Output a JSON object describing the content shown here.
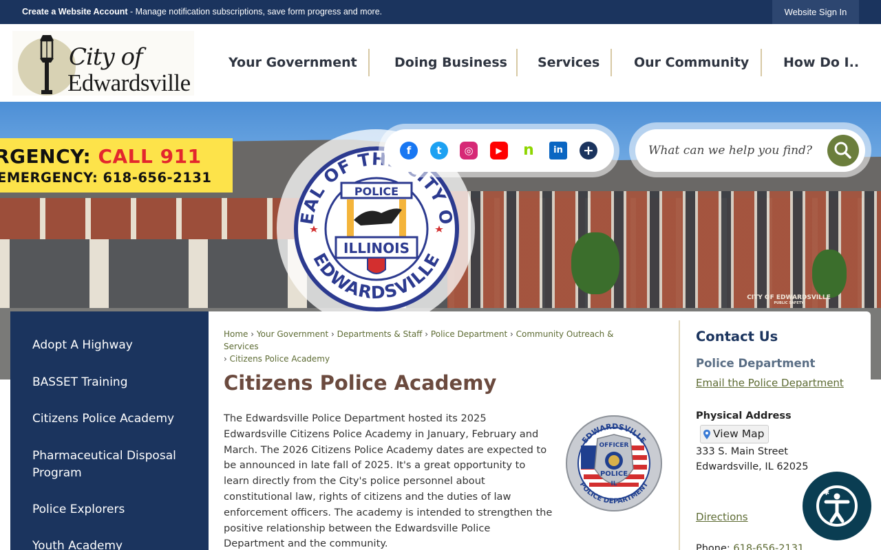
{
  "topbar": {
    "create_account": "Create a Website Account",
    "message": " - Manage notification subscriptions, save form progress and more.",
    "signin": "Website Sign In"
  },
  "logo": {
    "line1": "City of",
    "line2": "Edwardsville"
  },
  "nav": [
    {
      "label": "Your Government"
    },
    {
      "label": "Doing Business"
    },
    {
      "label": "Services"
    },
    {
      "label": "Our Community"
    },
    {
      "label": "How Do I.."
    }
  ],
  "banner": {
    "emergency_prefix": "RGENCY: ",
    "emergency_call": "CALL 911",
    "non_emergency": "EMERGENCY: 618-656-2131",
    "seal_top": "SEAL OF THE CITY OF",
    "seal_bottom": "EDWARDSVILLE",
    "seal_police": "POLICE",
    "seal_state": "ILLINOIS",
    "building_sign": "CITY OF EDWARDSVILLE",
    "building_sub": "PUBLIC SAFETY"
  },
  "social": [
    {
      "icon": "facebook-icon",
      "glyph": "f",
      "color": "#1877f2"
    },
    {
      "icon": "twitter-icon",
      "glyph": "t",
      "color": "#1da1f2"
    },
    {
      "icon": "instagram-icon",
      "glyph": "◎",
      "color": "#d62976"
    },
    {
      "icon": "youtube-icon",
      "glyph": "▶",
      "color": "#ff0000"
    },
    {
      "icon": "nextdoor-icon",
      "glyph": "n",
      "color": "#8ed500"
    },
    {
      "icon": "linkedin-icon",
      "glyph": "in",
      "color": "#0a66c2"
    },
    {
      "icon": "more-icon",
      "glyph": "+",
      "color": "#1b345e"
    }
  ],
  "search": {
    "placeholder": "What can we help you find?"
  },
  "sidebar": {
    "items": [
      {
        "label": "Adopt A Highway"
      },
      {
        "label": "BASSET Training"
      },
      {
        "label": "Citizens Police Academy"
      },
      {
        "label": "Pharmaceutical Disposal Program"
      },
      {
        "label": "Police Explorers"
      },
      {
        "label": "Youth Academy"
      }
    ]
  },
  "breadcrumb": {
    "items": [
      "Home",
      "Your Government",
      "Departments & Staff",
      "Police Department",
      "Community Outreach & Services",
      "Citizens Police Academy"
    ],
    "separator": "›"
  },
  "page": {
    "title": "Citizens Police Academy",
    "body": "The Edwardsville Police Department hosted its 2025 Edwardsville Citizens Police Academy in January, February and March. The 2026 Citizens Police Academy dates are expected to be announced in late fall of 2025. It's a great opportunity to learn directly from the City's police personnel about constitutional law, rights of citizens and the duties of law enforcement officers. The academy is intended to strengthen the positive relationship between the Edwardsville Police Department and the community.",
    "badge_top": "EDWARDSVILLE",
    "badge_bottom": "POLICE DEPARTMENT",
    "badge_officer": "OFFICER",
    "badge_police": "POLICE",
    "badge_state": "IL"
  },
  "contact": {
    "heading": "Contact Us",
    "department": "Police Department",
    "email_link": "Email the Police Department",
    "physical_heading": "Physical Address",
    "view_map": "View Map",
    "street": "333 S. Main Street",
    "city": "Edwardsville, IL 62025",
    "directions": "Directions",
    "phone_label": "Phone: ",
    "phone": "618-656-2131"
  },
  "colors": {
    "navy": "#1b345e",
    "accent_olive": "#5d6b33",
    "title_brown": "#6b4a3e",
    "emergency_yellow": "#fde34a",
    "emergency_red": "#e3272d"
  }
}
